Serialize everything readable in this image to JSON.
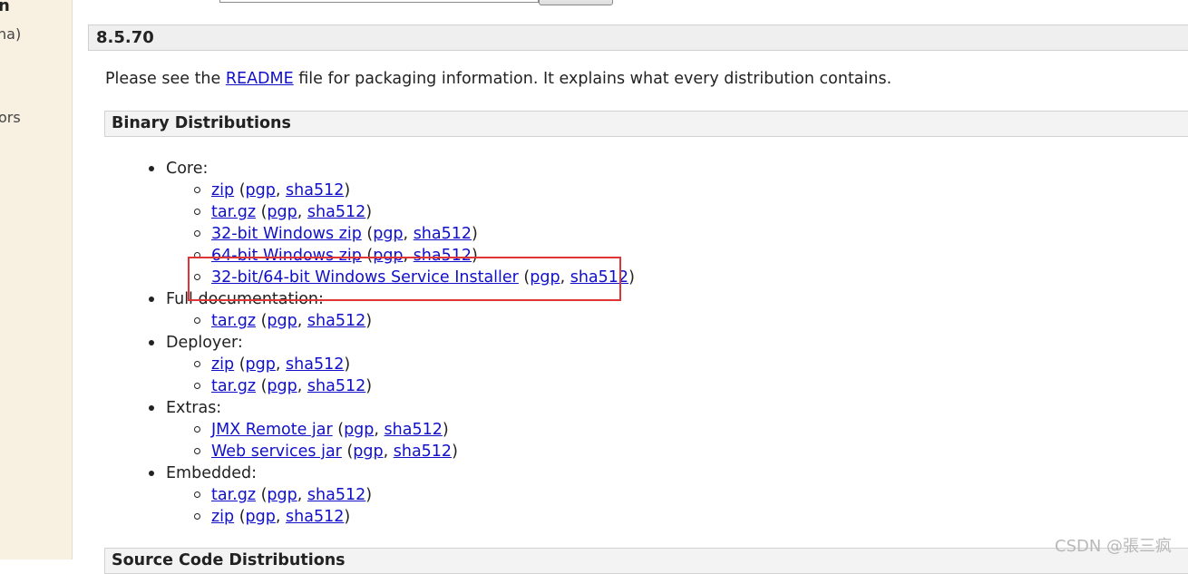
{
  "sidebar": {
    "fragments": [
      "n",
      "na)",
      "ors"
    ]
  },
  "version": "8.5.70",
  "intro": {
    "before": "Please see the ",
    "link": "README",
    "after": " file for packaging information. It explains what every distribution contains."
  },
  "binary_section": {
    "title": "Binary Distributions",
    "core_label": "Core:",
    "full_doc_label": "Full documentation:",
    "deployer_label": "Deployer:",
    "extras_label": "Extras:",
    "embedded_label": "Embedded:"
  },
  "links": {
    "zip": "zip",
    "targz": "tar.gz",
    "win32_zip": "32-bit Windows zip",
    "win64_zip": "64-bit Windows zip",
    "installer": "32-bit/64-bit Windows Service Installer",
    "jmx_jar": "JMX Remote jar",
    "ws_jar": "Web services jar",
    "pgp": "pgp",
    "sha512": "sha512"
  },
  "next_section": {
    "title": "Source Code Distributions"
  },
  "watermark": "CSDN @張三疯",
  "colors": {
    "link": "#1010c8",
    "highlight": "#e03535",
    "sidebar_bg": "#f8f0e1",
    "header_bg": "#efefef"
  }
}
